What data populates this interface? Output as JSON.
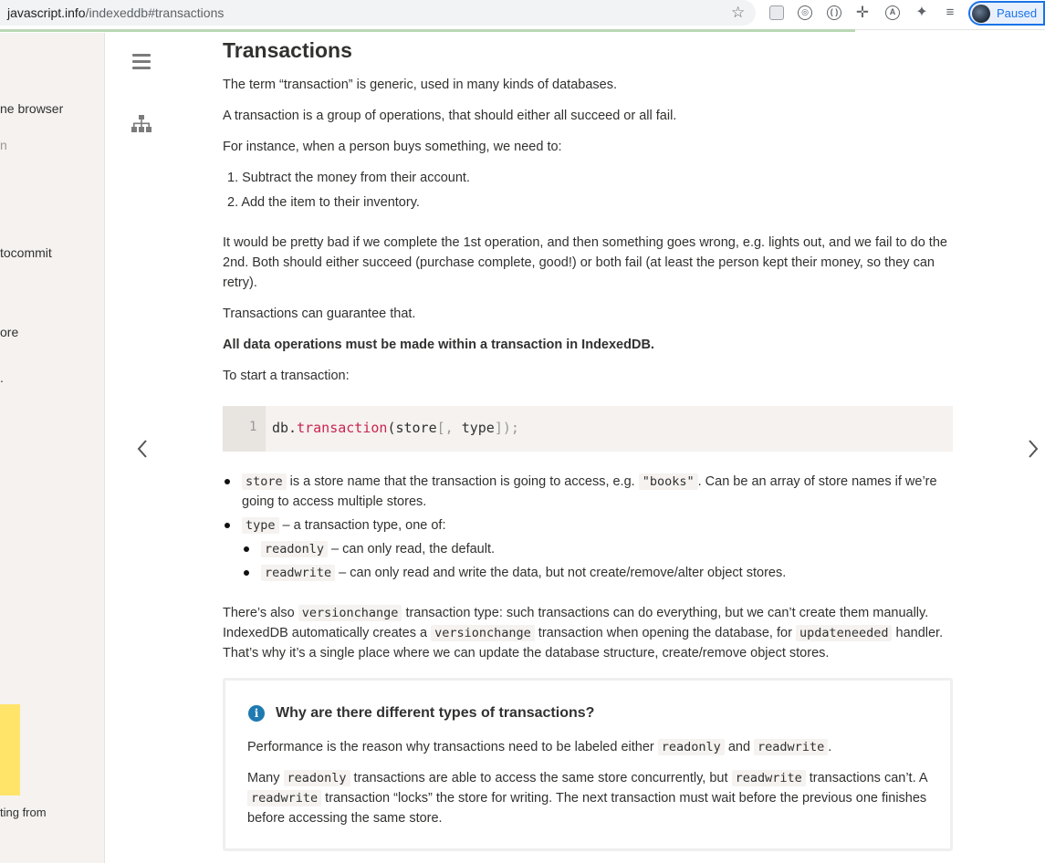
{
  "browser": {
    "url_host": "javascript.info",
    "url_path": "/indexeddb#transactions",
    "profile_label": "Paused"
  },
  "sidebar": {
    "items": [
      {
        "label": "ne browser",
        "muted": false
      },
      {
        "label": "n",
        "muted": true
      },
      {
        "label": "tocommit",
        "muted": false
      },
      {
        "label": "ore",
        "muted": false
      },
      {
        "label": ".",
        "muted": false
      }
    ],
    "footer_text": "ting from"
  },
  "article": {
    "title": "Transactions",
    "p1": "The term “transaction” is generic, used in many kinds of databases.",
    "p2": "A transaction is a group of operations, that should either all succeed or all fail.",
    "p3": "For instance, when a person buys something, we need to:",
    "steps": [
      "1. Subtract the money from their account.",
      "2. Add the item to their inventory."
    ],
    "p4": "It would be pretty bad if we complete the 1st operation, and then something goes wrong, e.g. lights out, and we fail to do the 2nd. Both should either succeed (purchase complete, good!) or both fail (at least the person kept their money, so they can retry).",
    "p5": "Transactions can guarantee that.",
    "p6": "All data operations must be made within a transaction in IndexedDB.",
    "p7": "To start a transaction:",
    "code": {
      "line_number": "1",
      "obj": "db.",
      "fn": "transaction",
      "args_a": "(store",
      "args_b": "[, ",
      "args_c": "type",
      "args_d": "]);"
    },
    "bullets": {
      "b1_code": "store",
      "b1_text_a": " is a store name that the transaction is going to access, e.g. ",
      "b1_code2": "\"books\"",
      "b1_text_b": ". Can be an array of store names if we’re going to access multiple stores.",
      "b2_code": "type",
      "b2_text": " – a transaction type, one of:",
      "b3_code": "readonly",
      "b3_text": " – can only read, the default.",
      "b4_code": "readwrite",
      "b4_text": " – can only read and write the data, but not create/remove/alter object stores."
    },
    "p8": {
      "a": "There’s also ",
      "c1": "versionchange",
      "b": " transaction type: such transactions can do everything, but we can’t create them manually. IndexedDB automatically creates a ",
      "c2": "versionchange",
      "c": " transaction when opening the database, for ",
      "c3": "updateneeded",
      "d": " handler. That’s why it’s a single place where we can update the database structure, create/remove object stores."
    },
    "note": {
      "title": "Why are there different types of transactions?",
      "n1_a": "Performance is the reason why transactions need to be labeled either ",
      "n1_c1": "readonly",
      "n1_b": " and ",
      "n1_c2": "readwrite",
      "n1_c": ".",
      "n2_a": "Many ",
      "n2_c1": "readonly",
      "n2_b": " transactions are able to access the same store concurrently, but ",
      "n2_c2": "readwrite",
      "n2_c": " transactions can’t. A ",
      "n2_c3": "readwrite",
      "n2_d": " transaction “locks” the store for writing. The next transaction must wait before the previous one finishes before accessing the same store."
    }
  },
  "icons": {
    "prev": "chevron-left-icon",
    "next": "chevron-right-icon",
    "menu": "hamburger-icon",
    "map": "sitemap-icon"
  }
}
